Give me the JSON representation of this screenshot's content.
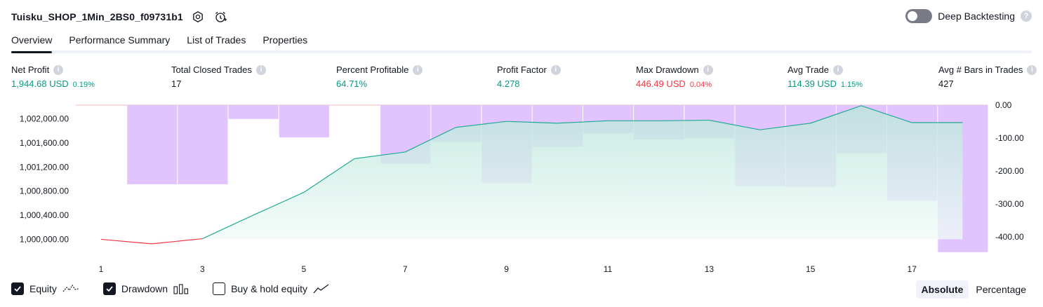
{
  "header": {
    "title": "Tuisku_SHOP_1Min_2BS0_f09731b1"
  },
  "deep_backtesting": {
    "label": "Deep Backtesting",
    "enabled": false
  },
  "tabs": [
    {
      "label": "Overview",
      "active": true
    },
    {
      "label": "Performance Summary",
      "active": false
    },
    {
      "label": "List of Trades",
      "active": false
    },
    {
      "label": "Properties",
      "active": false
    }
  ],
  "metrics": [
    {
      "label": "Net Profit",
      "value": "1,944.68 USD",
      "pct": "0.19%",
      "tone": "pos"
    },
    {
      "label": "Total Closed Trades",
      "value": "17",
      "pct": "",
      "tone": "neutral"
    },
    {
      "label": "Percent Profitable",
      "value": "64.71%",
      "pct": "",
      "tone": "pos"
    },
    {
      "label": "Profit Factor",
      "value": "4.278",
      "pct": "",
      "tone": "pos"
    },
    {
      "label": "Max Drawdown",
      "value": "446.49 USD",
      "pct": "0.04%",
      "tone": "neg"
    },
    {
      "label": "Avg Trade",
      "value": "114.39 USD",
      "pct": "1.15%",
      "tone": "pos"
    },
    {
      "label": "Avg # Bars in Trades",
      "value": "427",
      "pct": "",
      "tone": "neutral"
    }
  ],
  "chart_data": {
    "type": "line",
    "x": [
      1,
      2,
      3,
      4,
      5,
      6,
      7,
      8,
      9,
      10,
      11,
      12,
      13,
      14,
      15,
      16,
      17,
      18
    ],
    "x_ticks": [
      "1",
      "3",
      "5",
      "7",
      "9",
      "11",
      "13",
      "15",
      "17"
    ],
    "series": [
      {
        "name": "Equity",
        "axis": "left",
        "values": [
          1000000,
          999925,
          1000010,
          1000400,
          1000780,
          1001340,
          1001450,
          1001860,
          1001960,
          1001930,
          1001970,
          1001970,
          1001980,
          1001820,
          1001930,
          1002220,
          1001940,
          1001940
        ]
      },
      {
        "name": "Drawdown",
        "axis": "right",
        "type": "bar",
        "values": [
          0,
          -240,
          -240,
          -42,
          -98,
          0,
          -177,
          -112,
          -237,
          -126,
          -85,
          -104,
          -100,
          -246,
          -248,
          -146,
          -290,
          -446
        ]
      }
    ],
    "y_left_ticks": [
      "1,000,000.00",
      "1,000,400.00",
      "1,000,800.00",
      "1,001,200.00",
      "1,001,600.00",
      "1,002,000.00"
    ],
    "y_left_tick_values": [
      1000000,
      1000400,
      1000800,
      1001200,
      1001600,
      1002000
    ],
    "y_left_range": [
      999900,
      1002230
    ],
    "y_right_ticks": [
      "0.00",
      "-100.00",
      "-200.00",
      "-300.00",
      "-400.00"
    ],
    "y_right_tick_values": [
      0,
      -100,
      -200,
      -300,
      -400
    ],
    "y_right_range": [
      -446.49,
      0
    ],
    "colors": {
      "equity_up": "#22ab94",
      "equity_down": "#f23645",
      "drawdown": "#e1c4fd",
      "fill_top": "#bfe8dd",
      "fill_bottom": "#effaf7"
    }
  },
  "legend": [
    {
      "label": "Equity",
      "checked": true,
      "icon": "equity-line-icon"
    },
    {
      "label": "Drawdown",
      "checked": true,
      "icon": "drawdown-bars-icon"
    },
    {
      "label": "Buy & hold equity",
      "checked": false,
      "icon": "buyhold-line-icon"
    }
  ],
  "mode": {
    "absolute": "Absolute",
    "percentage": "Percentage",
    "selected": "absolute"
  }
}
